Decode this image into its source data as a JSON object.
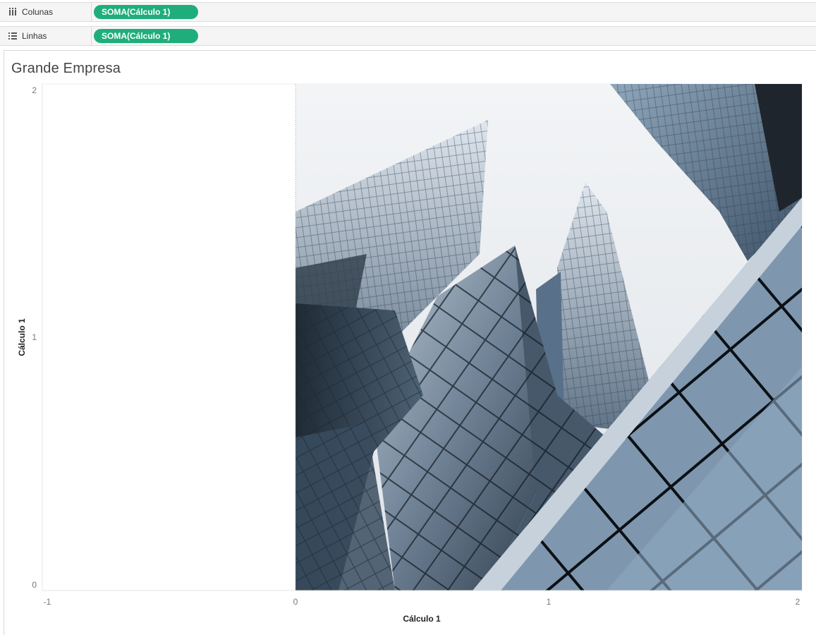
{
  "shelves": {
    "columns": {
      "label": "Colunas",
      "pill": "SOMA(Cálculo 1)"
    },
    "rows": {
      "label": "Linhas",
      "pill": "SOMA(Cálculo 1)"
    }
  },
  "sheet": {
    "title": "Grande Empresa"
  },
  "colors": {
    "pill": "#1fae7b",
    "shelf_bg": "#f5f5f5"
  },
  "chart_data": {
    "type": "scatter",
    "title": "Grande Empresa",
    "xlabel": "Cálculo 1",
    "ylabel": "Cálculo 1",
    "xlim": [
      -1,
      2
    ],
    "ylim": [
      0,
      2
    ],
    "x_ticks": [
      "-1",
      "0",
      "1",
      "2"
    ],
    "y_ticks": [
      "0",
      "1",
      "2"
    ],
    "background_image": {
      "x_range": [
        0,
        2
      ],
      "y_range": [
        0,
        2
      ],
      "description_icon": "glass-skyscrapers-image"
    },
    "series": []
  }
}
